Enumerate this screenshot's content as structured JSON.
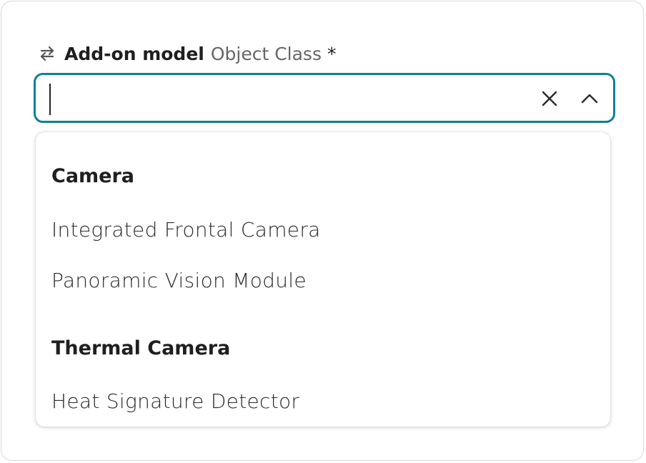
{
  "field": {
    "label_main": "Add-on model",
    "label_sub": "Object Class",
    "required_marker": "*",
    "icon": "swap-arrows-icon",
    "input_value": ""
  },
  "controls": {
    "clear_icon": "close-icon",
    "toggle_icon": "chevron-up-icon"
  },
  "colors": {
    "focus_border": "#0f7f9c",
    "text_primary": "#1f1f1f",
    "text_secondary": "#666666"
  },
  "dropdown": {
    "groups": [
      {
        "header": "Camera",
        "options": [
          "Integrated Frontal Camera",
          "Panoramic Vision Module"
        ]
      },
      {
        "header": "Thermal Camera",
        "options": [
          "Heat Signature Detector"
        ]
      }
    ]
  }
}
